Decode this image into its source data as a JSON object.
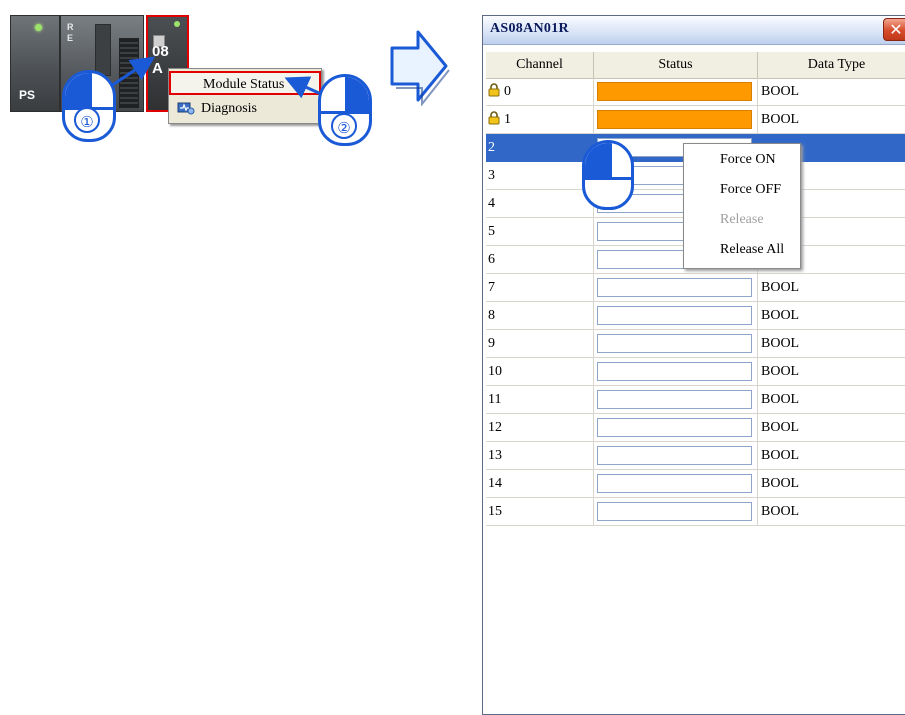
{
  "plc": {
    "ps_label": "PS",
    "cpu_letters": [
      "R",
      "E"
    ],
    "io_label_line1": "08",
    "io_label_line2": "A"
  },
  "left_menu": {
    "items": [
      {
        "label": "Module Status",
        "icon": "",
        "highlighted": true
      },
      {
        "label": "Diagnosis",
        "icon": "diagnosis-icon",
        "highlighted": false
      }
    ]
  },
  "callouts": {
    "step1": "①",
    "step2": "②"
  },
  "window": {
    "title": "AS08AN01R",
    "close_icon": "✕",
    "columns": [
      "Channel",
      "Status",
      "Data Type"
    ],
    "rows": [
      {
        "channel": "0",
        "locked": true,
        "status_on": true,
        "data_type": "BOOL"
      },
      {
        "channel": "1",
        "locked": true,
        "status_on": true,
        "data_type": "BOOL"
      },
      {
        "channel": "2",
        "locked": false,
        "status_on": false,
        "data_type": "",
        "selected": true
      },
      {
        "channel": "3",
        "locked": false,
        "status_on": false,
        "data_type": ""
      },
      {
        "channel": "4",
        "locked": false,
        "status_on": false,
        "data_type": ""
      },
      {
        "channel": "5",
        "locked": false,
        "status_on": false,
        "data_type": ""
      },
      {
        "channel": "6",
        "locked": false,
        "status_on": false,
        "data_type": ""
      },
      {
        "channel": "7",
        "locked": false,
        "status_on": false,
        "data_type": "BOOL"
      },
      {
        "channel": "8",
        "locked": false,
        "status_on": false,
        "data_type": "BOOL"
      },
      {
        "channel": "9",
        "locked": false,
        "status_on": false,
        "data_type": "BOOL"
      },
      {
        "channel": "10",
        "locked": false,
        "status_on": false,
        "data_type": "BOOL"
      },
      {
        "channel": "11",
        "locked": false,
        "status_on": false,
        "data_type": "BOOL"
      },
      {
        "channel": "12",
        "locked": false,
        "status_on": false,
        "data_type": "BOOL"
      },
      {
        "channel": "13",
        "locked": false,
        "status_on": false,
        "data_type": "BOOL"
      },
      {
        "channel": "14",
        "locked": false,
        "status_on": false,
        "data_type": "BOOL"
      },
      {
        "channel": "15",
        "locked": false,
        "status_on": false,
        "data_type": "BOOL"
      }
    ]
  },
  "right_menu": {
    "items": [
      {
        "label": "Force ON",
        "enabled": true
      },
      {
        "label": "Force OFF",
        "enabled": true
      },
      {
        "label": "Release",
        "enabled": false
      },
      {
        "label": "Release All",
        "enabled": true
      }
    ]
  },
  "colors": {
    "status_on": "#ff9900",
    "selection": "#3168c8",
    "callout_blue": "#1b5ad6",
    "highlight_red": "#e00000"
  }
}
